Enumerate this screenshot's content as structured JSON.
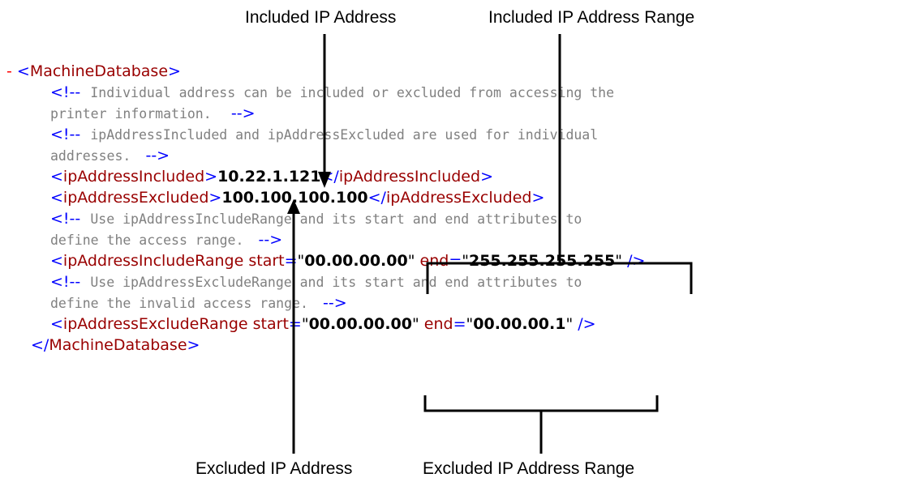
{
  "callouts": {
    "included_ip_address": "Included IP Address",
    "included_ip_address_range": "Included IP Address Range",
    "excluded_ip_address": "Excluded IP Address",
    "excluded_ip_address_range": "Excluded IP Address Range"
  },
  "xml": {
    "collapse_marker": "-",
    "root_tag": "MachineDatabase",
    "comment_open": "<!--",
    "comment_close": "-->",
    "comment1_line1": "Individual address can be included or excluded from accessing the",
    "comment1_line2": "printer information.",
    "comment2_line1": "ipAddressIncluded and ipAddressExcluded are used for individual",
    "comment2_line2": "addresses.",
    "included_tag": "ipAddressIncluded",
    "included_value": "10.22.1.121",
    "excluded_tag": "ipAddressExcluded",
    "excluded_value": "100.100.100.100",
    "comment3_line1": "Use ipAddressIncludeRange and its start and end attributes to",
    "comment3_line2": "define the access range.",
    "include_range_tag": "ipAddressIncludeRange",
    "attr_start": "start",
    "attr_end": "end",
    "include_range_start": "00.00.00.00",
    "include_range_end": "255.255.255.255",
    "comment4_line1": "Use ipAddressExcludeRange and its start and end attributes to",
    "comment4_line2": "define the invalid access range.",
    "exclude_range_tag": "ipAddressExcludeRange",
    "exclude_range_start": "00.00.00.00",
    "exclude_range_end": "00.00.00.1"
  }
}
